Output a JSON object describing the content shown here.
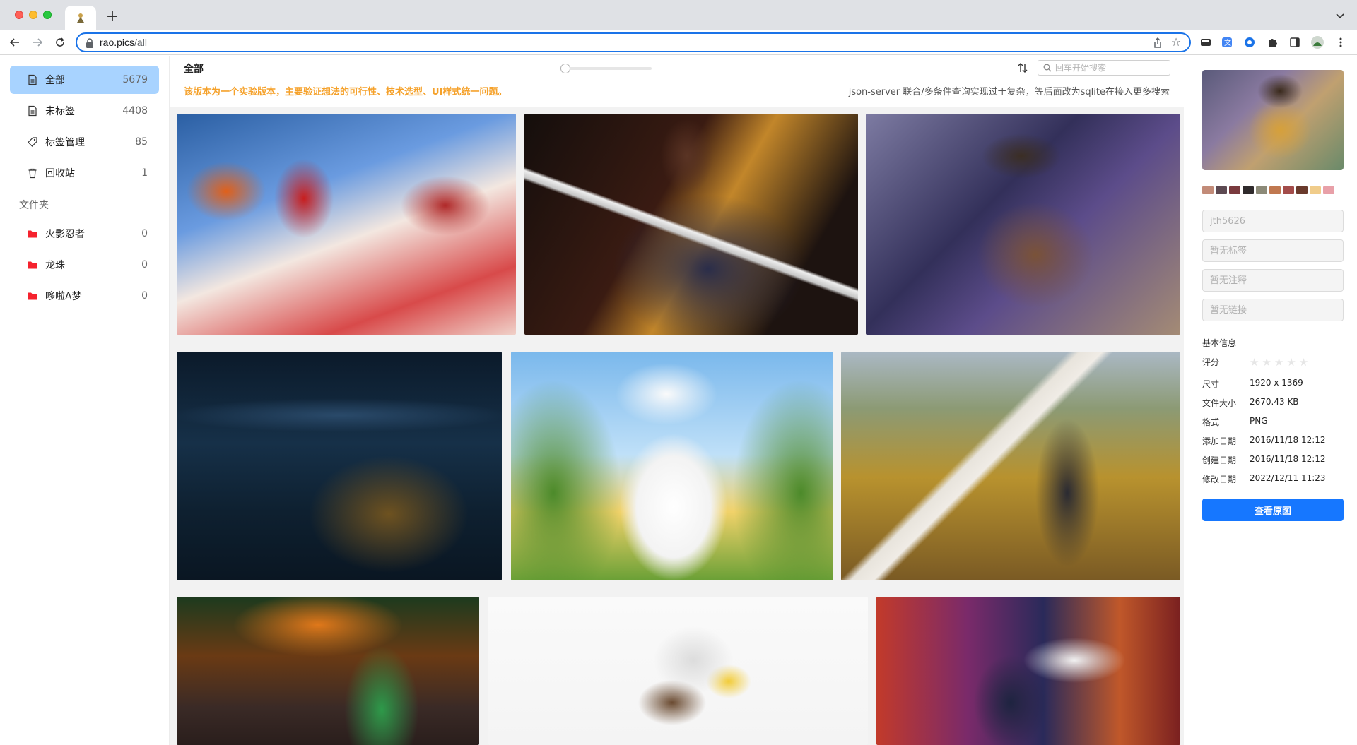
{
  "browser": {
    "url_host": "rao.pics",
    "url_path": "/all",
    "new_tab_label": "+"
  },
  "sidebar": {
    "items": [
      {
        "label": "全部",
        "count": "5679",
        "icon": "file-icon"
      },
      {
        "label": "未标签",
        "count": "4408",
        "icon": "file-icon"
      },
      {
        "label": "标签管理",
        "count": "85",
        "icon": "tag-icon"
      },
      {
        "label": "回收站",
        "count": "1",
        "icon": "trash-icon"
      }
    ],
    "folder_title": "文件夹",
    "folders": [
      {
        "label": "火影忍者",
        "count": "0",
        "icon": "folder-icon",
        "color": "#f5222d"
      },
      {
        "label": "龙珠",
        "count": "0",
        "icon": "folder-icon",
        "color": "#f5222d"
      },
      {
        "label": "哆啦A梦",
        "count": "0",
        "icon": "folder-icon",
        "color": "#f5222d"
      }
    ]
  },
  "header": {
    "title": "全部",
    "notice_left": "该版本为一个实验版本，主要验证想法的可行性、技术选型、UI样式统一问题。",
    "notice_right": "json-server 联合/多条件查询实现过于复杂，等后面改为sqlite在接入更多搜索",
    "search_placeholder": "回车开始搜索",
    "sort_icon": "sort-icon",
    "search_icon": "search-icon"
  },
  "detail": {
    "palette": [
      "#c28b78",
      "#5d4a52",
      "#7a3a3e",
      "#2f2a2c",
      "#8c8a78",
      "#c07850",
      "#a34c4a",
      "#6a3a2c",
      "#f0cc8a",
      "#e8a0a8"
    ],
    "name_value": "jth5626",
    "tags_placeholder": "暂无标签",
    "note_placeholder": "暂无注释",
    "link_placeholder": "暂无链接",
    "info_title": "基本信息",
    "rating_label": "评分",
    "rating_stars": "★★★★★",
    "rows": [
      {
        "label": "尺寸",
        "value": "1920 x 1369"
      },
      {
        "label": "文件大小",
        "value": "2670.43 KB"
      },
      {
        "label": "格式",
        "value": "PNG"
      },
      {
        "label": "添加日期",
        "value": "2016/11/18 12:12"
      },
      {
        "label": "创建日期",
        "value": "2016/11/18 12:12"
      },
      {
        "label": "修改日期",
        "value": "2022/12/11 11:23"
      }
    ],
    "view_button": "查看原图"
  }
}
